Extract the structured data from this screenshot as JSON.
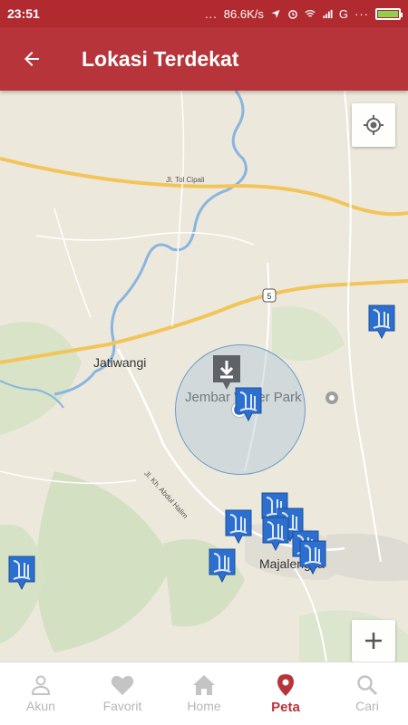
{
  "status_bar": {
    "time": "23:51",
    "network_speed": "86.6K/s",
    "carrier_letter": "G"
  },
  "app_bar": {
    "title": "Lokasi Terdekat"
  },
  "map": {
    "labels": {
      "town1": "Jatiwangi",
      "town2": "Majalengka",
      "poi": "Jembar Water Park",
      "toll_road": "Jl. Tol Cipali",
      "street": "Jl. Kh. Abdul Halim",
      "route_number": "5"
    },
    "colors": {
      "road": "#f2c55a",
      "water": "#8ab4e0",
      "marker": "#2c6fcf",
      "accent": "#b7353a"
    }
  },
  "bottom_nav": {
    "items": [
      {
        "label": "Akun",
        "icon": "person-icon"
      },
      {
        "label": "Favorit",
        "icon": "heart-icon"
      },
      {
        "label": "Home",
        "icon": "home-icon"
      },
      {
        "label": "Peta",
        "icon": "map-pin-icon"
      },
      {
        "label": "Cari",
        "icon": "search-icon"
      }
    ],
    "active": "Peta"
  }
}
